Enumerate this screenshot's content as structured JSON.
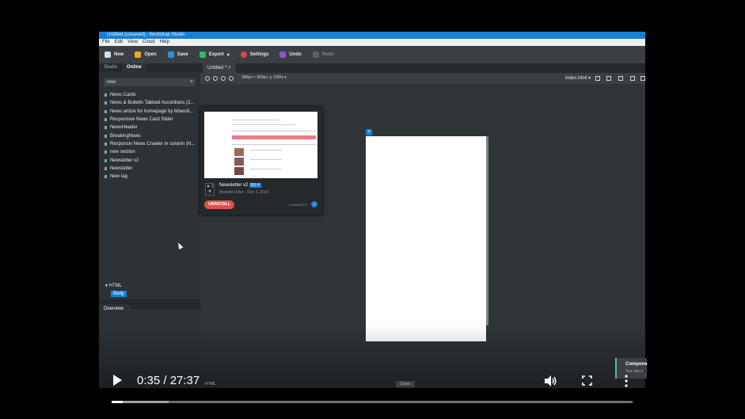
{
  "window": {
    "title": "Untitled (unsaved) - Bootstrap Studio",
    "menu": [
      "File",
      "Edit",
      "View",
      "Cloud",
      "Help"
    ]
  },
  "toolbar": {
    "buttons": [
      {
        "label": "New",
        "icon": "file-icon",
        "color": "#d9dde0"
      },
      {
        "label": "Open",
        "icon": "folder-icon",
        "color": "#f0a830"
      },
      {
        "label": "Save",
        "icon": "floppy-icon",
        "color": "#2f8fdc"
      },
      {
        "label": "Export",
        "icon": "export-icon",
        "color": "#2fb86b"
      },
      {
        "label": "Settings",
        "icon": "gear-icon",
        "color": "#e0443e"
      },
      {
        "label": "Undo",
        "icon": "undo-icon",
        "color": "#8b55c6"
      },
      {
        "label": "Redo",
        "icon": "redo-icon",
        "color": "#5a5f63",
        "disabled": true
      }
    ]
  },
  "left_panel": {
    "tabs": [
      "Studio",
      "Online"
    ],
    "active_tab": "Online",
    "search_value": "new",
    "search_clear": "×",
    "components": [
      "News Cards",
      "News & Bulletin Tabbed Accordians (2...",
      "News article for homepage by lkbendi...",
      "Responsive News Card Slider",
      "NewsHeader",
      "BreakingNews",
      "Responsiv News Crawler in column (N...",
      "new section",
      "Newsletter v2",
      "Newsletter",
      "New tag"
    ],
    "overview_tab": "Overview",
    "tree": {
      "root": "▾ HTML",
      "child": "Body"
    }
  },
  "popup": {
    "title": "Newsletter v2",
    "badge": "BS 4",
    "author": "Brandon Erler · Dec 3, 2019",
    "vote": "▲ 1 ▼",
    "uninstall_label": "UNINSTALL",
    "comments_label": "COMMENTS",
    "comments_count": "0"
  },
  "design": {
    "doc_tab": "Untitled * ×",
    "viewport": "380px × 800px ◎ 100% ▾",
    "page_select": "index.html ▾",
    "canvas_marker": "+"
  },
  "bottom": {
    "html_label": "HTML",
    "styles_label": "Styles",
    "toast_title": "Compone",
    "toast_body": "You can n"
  },
  "player": {
    "time": "0:35 / 27:37",
    "played_fraction": 0.021,
    "buffered_fraction": 0.11
  }
}
